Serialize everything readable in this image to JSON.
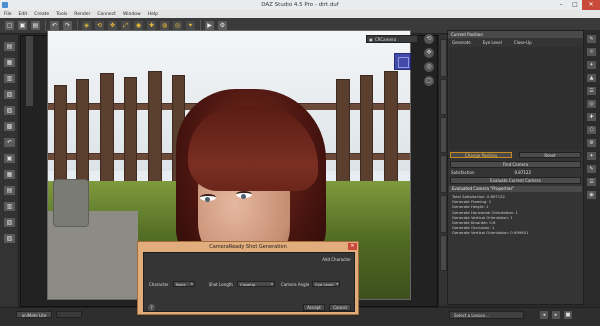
{
  "window": {
    "title": "DAZ Studio 4.5 Pro - dirt.duf",
    "min": "–",
    "max": "□",
    "close": "✕"
  },
  "menu": [
    "File",
    "Edit",
    "Create",
    "Tools",
    "Render",
    "Connect",
    "Window",
    "Help"
  ],
  "toolbar": {
    "icons": [
      "new-icon",
      "open-icon",
      "save-icon",
      "undo-icon",
      "redo-icon",
      "pointer-icon",
      "rotate-icon",
      "translate-icon",
      "scale-icon",
      "node-icon",
      "joint-icon",
      "surface-icon",
      "camera-icon",
      "spot-light-icon",
      "render-icon",
      "render-settings-icon"
    ],
    "glyphs": [
      "▢",
      "▣",
      "▤",
      "↶",
      "↷",
      "◈",
      "⟲",
      "✥",
      "⤢",
      "◉",
      "✚",
      "◍",
      "◎",
      "✦",
      "▶",
      "⚙"
    ]
  },
  "leftstrip": {
    "glyphs": [
      "▤",
      "▦",
      "▥",
      "▧",
      "▨",
      "▩",
      "↶",
      "▣",
      "▦",
      "▤",
      "▥",
      "▧",
      "▨"
    ]
  },
  "viewport": {
    "camera_label": "CRCamera"
  },
  "panel": {
    "header": "Current Position",
    "columns": [
      "Generate",
      "Eye Level",
      "Close-Up"
    ],
    "change_position": "Change Position",
    "reset": "Reset",
    "find_camera": "Find Camera",
    "satisfaction_label": "Satisfaction",
    "satisfaction_value": "0.87122",
    "evaluate": "Evaluate Current Camera",
    "section": "Evaluated Camera \"Properties\"",
    "props": [
      "Total Satisfaction: 0.897122",
      "Generate Framing: 1",
      "Generate Height: 1",
      "Generate Horizontal Orientation: 1",
      "Generate Vertical Orientation: 1",
      "Generate Kinorder: 0.6",
      "Generate Occlusion: 1",
      "Generate Vertical Orientation: 0.999951"
    ]
  },
  "rightstrip": {
    "tabs": [
      "Scene",
      "Parameters",
      "Surfaces",
      "Smart Content",
      "Content Library",
      "Shaping"
    ]
  },
  "farright": {
    "glyphs": [
      "✎",
      "☼",
      "✦",
      "▲",
      "☰",
      "◎",
      "✚",
      "⬡",
      "⚙",
      "✦",
      "✎",
      "☰",
      "◉"
    ]
  },
  "bottombar": {
    "tab_animate": "aniMate Lite",
    "lesson": "Select a Lesson...",
    "icons": [
      "◂",
      "▸",
      "■"
    ]
  },
  "dialog": {
    "title": "CameraReady Shot Generation",
    "add_character": "Add Character",
    "character_label": "Character",
    "character_value": "None",
    "shot_length_label": "Shot Length",
    "shot_length_value": "CloseUp",
    "camera_angle_label": "Camera Angle",
    "camera_angle_value": "Eye Level",
    "help": "?",
    "accept": "Accept",
    "cancel": "Cancel"
  }
}
